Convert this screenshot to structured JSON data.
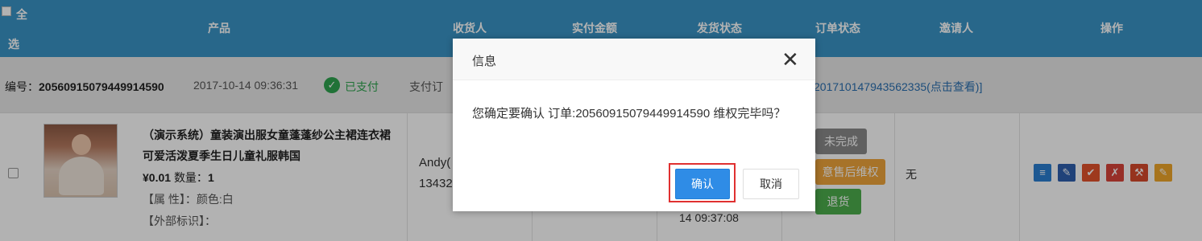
{
  "header": {
    "select_all_line1": "全",
    "select_all_line2": "选",
    "columns": [
      "产品",
      "收货人",
      "实付金额",
      "发货状态",
      "订单状态",
      "邀请人",
      "操作"
    ]
  },
  "order": {
    "number_label": "编号：",
    "number": "20560915079449914590",
    "time": "2017-10-14 09:36:31",
    "paid_status": "已支付",
    "payment_label": "支付订",
    "link": "201710147943562335(点击查看)]"
  },
  "product": {
    "name": "（演示系统）童装演出服女童蓬蓬纱公主裙连衣裙可爱活泼夏季生日儿童礼服韩国",
    "price": "¥0.01",
    "quantity_label": "数量：",
    "quantity": "1",
    "attr": "【属 性】：颜色:白",
    "external": "【外部标识】："
  },
  "receiver": {
    "name": "Andy(",
    "phone": "13432"
  },
  "shipping": {
    "time": "14 09:37:08"
  },
  "order_status": {
    "unfinished_label": "未完成",
    "after_sale_label": "意售后维权",
    "return_label": "退货"
  },
  "inviter": "无",
  "ops_icons": [
    {
      "name": "edit-doc-icon",
      "color": "#2a7fd1",
      "glyph": "≡"
    },
    {
      "name": "edit-frame-icon",
      "color": "#2e5fae",
      "glyph": "✎"
    },
    {
      "name": "check-icon",
      "color": "#e2522b",
      "glyph": "✔"
    },
    {
      "name": "cancel-doc-icon",
      "color": "#d9443a",
      "glyph": "✗"
    },
    {
      "name": "judge-hammer-icon",
      "color": "#d74a2b",
      "glyph": "⚒"
    },
    {
      "name": "note-edit-icon",
      "color": "#f0a62a",
      "glyph": "✎"
    }
  ],
  "dialog": {
    "title": "信息",
    "message": "您确定要确认 订单:20560915079449914590 维权完毕吗？",
    "confirm_label": "确认",
    "cancel_label": "取消"
  }
}
